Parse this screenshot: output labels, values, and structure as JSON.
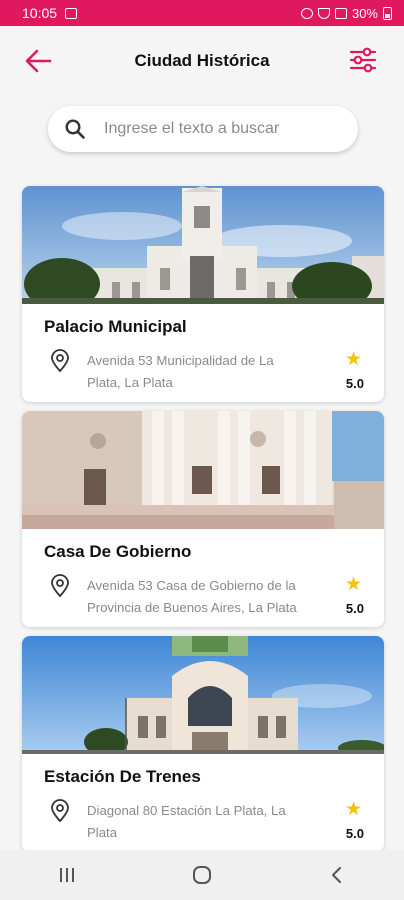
{
  "status_bar": {
    "time": "10:05",
    "battery": "30%"
  },
  "header": {
    "title": "Ciudad Histórica"
  },
  "search": {
    "placeholder": "Ingrese el texto a buscar"
  },
  "places": [
    {
      "name": "Palacio Municipal",
      "address": "Avenida 53 Municipalidad de La Plata, La Plata",
      "rating": "5.0"
    },
    {
      "name": "Casa De Gobierno",
      "address": "Avenida 53 Casa de Gobierno de la Provincia de Buenos Aires, La Plata",
      "rating": "5.0"
    },
    {
      "name": "Estación De Trenes",
      "address": "Diagonal 80 Estación La Plata, La Plata",
      "rating": "5.0"
    }
  ],
  "colors": {
    "accent": "#e0195e",
    "star": "#f7c20c",
    "background": "#f5f5f5"
  },
  "icons": {
    "back": "arrow-left-icon",
    "filter": "sliders-icon",
    "search": "search-icon",
    "location": "location-pin-icon",
    "rating": "star-icon"
  }
}
